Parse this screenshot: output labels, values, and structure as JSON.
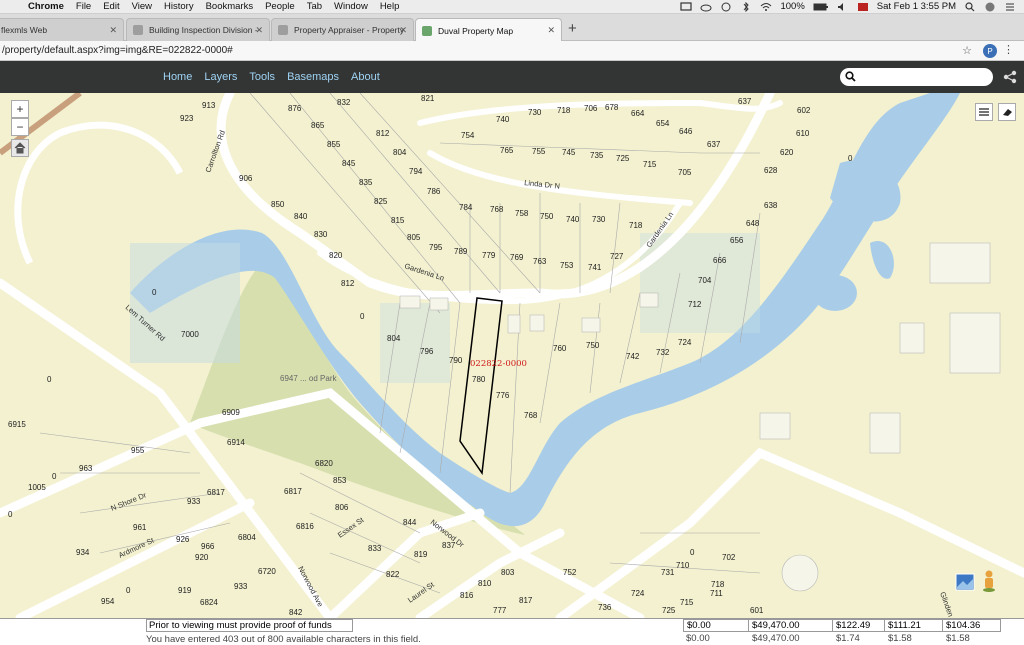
{
  "menubar": {
    "app": "Chrome",
    "items": [
      "File",
      "Edit",
      "View",
      "History",
      "Bookmarks",
      "People",
      "Tab",
      "Window",
      "Help"
    ],
    "battery": "100%",
    "clock": "Sat Feb 1  3:55 PM"
  },
  "tabs": [
    {
      "title": "flexmls Web"
    },
    {
      "title": "Building Inspection Division -"
    },
    {
      "title": "Property Appraiser - Property"
    },
    {
      "title": "Duval Property Map"
    }
  ],
  "address": {
    "url": "/property/default.aspx?img=img&RE=022822-0000#",
    "profile_initial": "P"
  },
  "nav": {
    "items": [
      "Home",
      "Layers",
      "Tools",
      "Basemaps",
      "About"
    ]
  },
  "map": {
    "parcel_id": "022822-0000",
    "park_label": "6947 ... od Park",
    "streets": [
      "Carrollton Rd",
      "Linda Dr N",
      "Gardenia Ln",
      "Gardenia Ln",
      "Lem Turner Rd",
      "N Shore Dr",
      "Ardmore St",
      "Essex St",
      "Norwood Dr",
      "Norwood Ave",
      "Laurel St",
      "Glinden R"
    ],
    "parcels": [
      "913",
      "923",
      "876",
      "832",
      "821",
      "865",
      "812",
      "855",
      "845",
      "804",
      "835",
      "794",
      "786",
      "825",
      "906",
      "850",
      "840",
      "830",
      "815",
      "805",
      "820",
      "812",
      "795",
      "789",
      "779",
      "769",
      "763",
      "753",
      "741",
      "727",
      "784",
      "768",
      "758",
      "750",
      "740",
      "730",
      "718",
      "754",
      "740",
      "730",
      "718",
      "706",
      "678",
      "664",
      "654",
      "646",
      "637",
      "765",
      "755",
      "745",
      "735",
      "725",
      "715",
      "705",
      "637",
      "602",
      "610",
      "620",
      "0",
      "628",
      "638",
      "648",
      "656",
      "666",
      "704",
      "712",
      "724",
      "732",
      "742",
      "750",
      "760",
      "768",
      "776",
      "780",
      "790",
      "796",
      "804",
      "0",
      "0",
      "7000",
      "0",
      "6915",
      "6909",
      "6914",
      "955",
      "0",
      "963",
      "1005",
      "0",
      "933",
      "961",
      "934",
      "926",
      "920",
      "966",
      "954",
      "0",
      "919",
      "933",
      "6824",
      "6817",
      "6817",
      "6816",
      "6804",
      "6720",
      "842",
      "6820",
      "853",
      "806",
      "844",
      "833",
      "819",
      "837",
      "822",
      "816",
      "810",
      "803",
      "817",
      "777",
      "752",
      "736",
      "724",
      "731",
      "725",
      "715",
      "711",
      "718",
      "710",
      "0",
      "702",
      "601"
    ]
  },
  "bottom": {
    "msg1": "Prior to viewing must provide proof of funds",
    "msg2": "You have entered 403 out of 800 available characters in this field.",
    "cells": [
      "$0.00",
      "$49,470.00",
      "$122.49",
      "$111.21",
      "$104.36"
    ],
    "cells2": [
      "$0.00",
      "$49,470.00",
      "$1.74",
      "$1.58",
      "$1.58"
    ]
  },
  "colors": {
    "nav_bg": "#333534",
    "nav_link": "#9fd3f4",
    "map_bg": "#f3f1cf",
    "water": "#a9cde8",
    "park": "#d7dfae",
    "parcel_line": "#000000",
    "parcel_label": "#d11a1a"
  }
}
